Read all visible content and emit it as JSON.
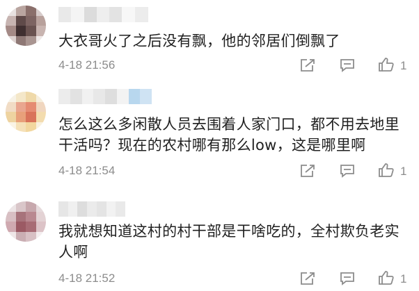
{
  "comments": [
    {
      "text": "大衣哥火了之后没有飘，他的邻居们倒飘了",
      "time": "4-18 21:56",
      "likes": "1",
      "avatar_colors": [
        "#e8e2e1",
        "#b9a5a0",
        "#8a6f6b",
        "#d7cccb",
        "#c7b4b1",
        "#5f4a49",
        "#7d6462",
        "#b8a19c",
        "#a48a86",
        "#3f2f30",
        "#695250",
        "#c8b4b0",
        "#ddd2d0",
        "#8e7875",
        "#a99591",
        "#efe9e8"
      ],
      "name_colors": [
        "#e9e9e9",
        "#f4f4f4",
        "#dcdcdc",
        "#eeeeee",
        "#e3e3e3",
        "#f7f7f7",
        "#ececec"
      ]
    },
    {
      "text": "怎么这么多闲散人员去围着人家门口，都不用去地里干活吗？现在的农村哪有那么low，这是哪里啊",
      "time": "4-18 21:54",
      "likes": "1",
      "avatar_colors": [
        "#f7f2e6",
        "#f4e7c9",
        "#efd9a9",
        "#f6eedd",
        "#f1dcc5",
        "#e9a68f",
        "#e58b72",
        "#f0d6bf",
        "#eed3a0",
        "#e8a07a",
        "#d9735a",
        "#f3dcae",
        "#faf4e6",
        "#f5e1b9",
        "#f2d79f",
        "#f9f1e0"
      ],
      "name_colors": [
        "#ececec",
        "#e2e2e2",
        "#f1f1f1",
        "#e8e8e8",
        "#dedede",
        "#f3f3f3",
        "#b8d7ee",
        "#cfe3f3"
      ]
    },
    {
      "text": "我就想知道这村的村干部是干啥吃的，全村欺负老实人啊",
      "time": "4-18 21:52",
      "likes": "1",
      "avatar_colors": [
        "#ece4e5",
        "#d9c6c9",
        "#c7a8ad",
        "#e6dadc",
        "#d8bfc3",
        "#a7737b",
        "#b98890",
        "#e3d2d4",
        "#cfa9b0",
        "#9b5a64",
        "#a86c75",
        "#dcc3c7",
        "#efe7e8",
        "#caaeb3",
        "#d8c0c4",
        "#f4eeef"
      ],
      "name_colors": [
        "#e6e6e6",
        "#f0f0f0",
        "#dddddd",
        "#ebebeb",
        "#e4e4e4",
        "#f2f2f2",
        "#e9e9e9"
      ]
    }
  ],
  "icons": {
    "share": "share-icon",
    "reply": "comment-icon",
    "like": "thumbs-up-icon"
  }
}
